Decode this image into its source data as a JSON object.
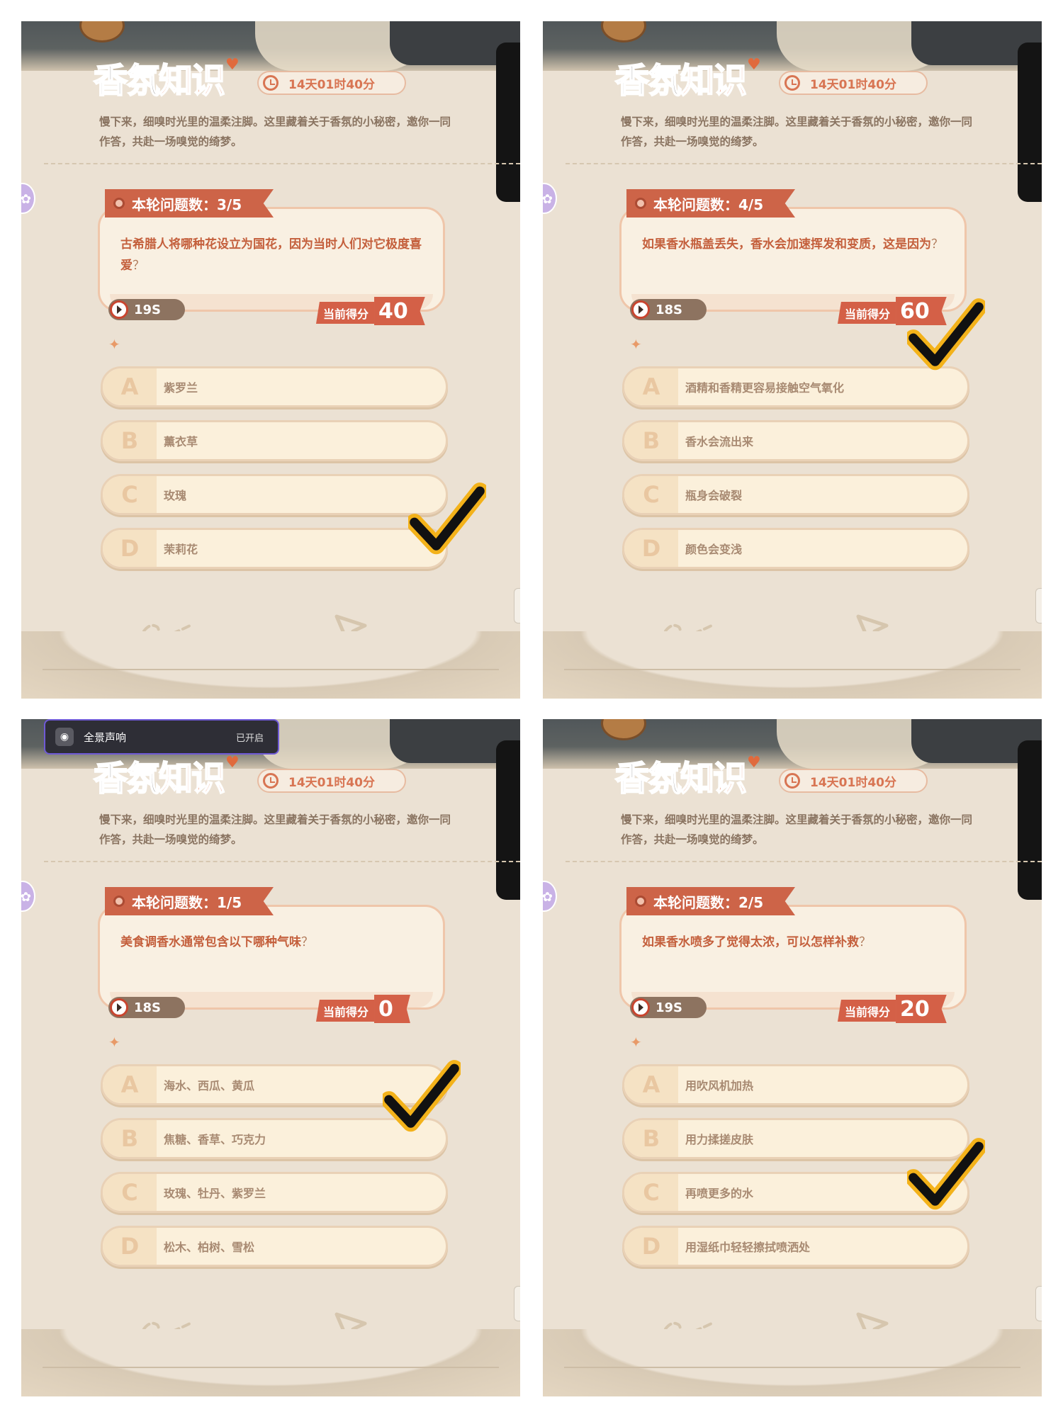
{
  "title": {
    "part1": "香氛",
    "part2": "知识"
  },
  "timer": "14天01时40分",
  "intro": "慢下来，细嗅时光里的温柔注脚。这里藏着关于香氛的小秘密，邀你一同作答，共赴一场嗅觉的绮梦。",
  "score_label": "当前得分",
  "audio_toast": {
    "label": "全景声响",
    "status": "已开启"
  },
  "panels": [
    {
      "badge": "本轮问题数：3/5",
      "question": "古希腊人将哪种花设立为国花，因为当时人们对它极度喜爱",
      "qmark": "？",
      "seconds": "19S",
      "score": "40",
      "correct": "D",
      "options": [
        {
          "letter": "A",
          "text": "紫罗兰"
        },
        {
          "letter": "B",
          "text": "薰衣草"
        },
        {
          "letter": "C",
          "text": "玫瑰"
        },
        {
          "letter": "D",
          "text": "茉莉花"
        }
      ]
    },
    {
      "badge": "本轮问题数：4/5",
      "question": "如果香水瓶盖丢失，香水会加速挥发和变质，这是因为",
      "qmark": "？",
      "seconds": "18S",
      "score": "60",
      "correct": "A",
      "options": [
        {
          "letter": "A",
          "text": "酒精和香精更容易接触空气氧化"
        },
        {
          "letter": "B",
          "text": "香水会流出来"
        },
        {
          "letter": "C",
          "text": "瓶身会破裂"
        },
        {
          "letter": "D",
          "text": "颜色会变浅"
        }
      ]
    },
    {
      "badge": "本轮问题数：1/5",
      "question": "美食调香水通常包含以下哪种气味",
      "qmark": "？",
      "seconds": "18S",
      "score": "0",
      "correct": "B",
      "options": [
        {
          "letter": "A",
          "text": "海水、西瓜、黄瓜"
        },
        {
          "letter": "B",
          "text": "焦糖、香草、巧克力"
        },
        {
          "letter": "C",
          "text": "玫瑰、牡丹、紫罗兰"
        },
        {
          "letter": "D",
          "text": "松木、柏树、雪松"
        }
      ]
    },
    {
      "badge": "本轮问题数：2/5",
      "question": "如果香水喷多了觉得太浓，可以怎样补救",
      "qmark": "？",
      "seconds": "19S",
      "score": "20",
      "correct": "D",
      "options": [
        {
          "letter": "A",
          "text": "用吹风机加热"
        },
        {
          "letter": "B",
          "text": "用力揉搓皮肤"
        },
        {
          "letter": "C",
          "text": "再喷更多的水"
        },
        {
          "letter": "D",
          "text": "用湿纸巾轻轻擦拭喷洒处"
        }
      ]
    }
  ],
  "colors": {
    "accent": "#cd6448",
    "panel_bg": "#ebe1d3",
    "check_fill": "#111111",
    "check_outline": "#f3b21a"
  }
}
